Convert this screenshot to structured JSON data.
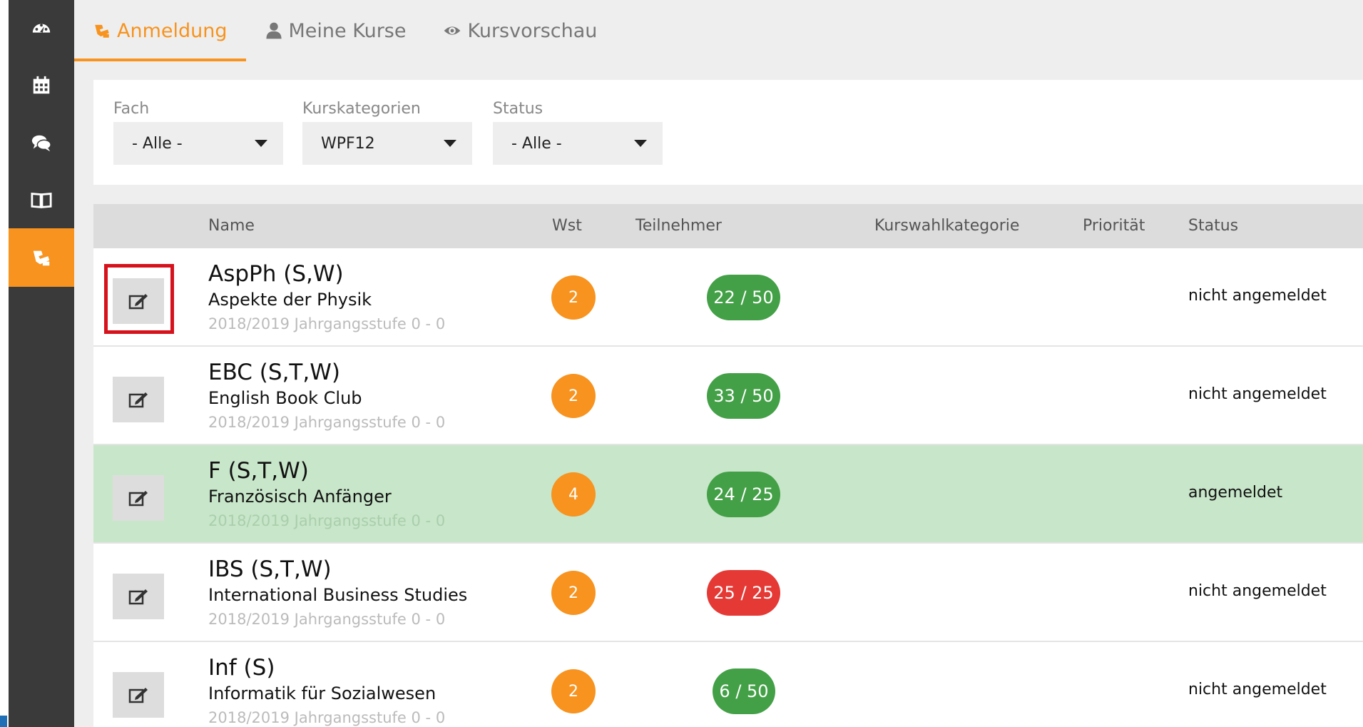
{
  "sidebar": {
    "items": [
      {
        "icon": "dashboard-icon"
      },
      {
        "icon": "calendar-icon"
      },
      {
        "icon": "comments-icon"
      },
      {
        "icon": "book-icon"
      },
      {
        "icon": "course-registration-icon",
        "active": true
      }
    ]
  },
  "tabs": [
    {
      "label": "Anmeldung",
      "icon": "registration-icon",
      "active": true
    },
    {
      "label": "Meine Kurse",
      "icon": "user-icon"
    },
    {
      "label": "Kursvorschau",
      "icon": "eye-icon"
    }
  ],
  "filters": {
    "fach": {
      "label": "Fach",
      "value": "- Alle -"
    },
    "kategorie": {
      "label": "Kurskategorien",
      "value": "WPF12"
    },
    "status": {
      "label": "Status",
      "value": "- Alle -"
    }
  },
  "table": {
    "headers": {
      "name": "Name",
      "wst": "Wst",
      "teilnehmer": "Teilnehmer",
      "kurswahlkategorie": "Kurswahlkategorie",
      "prioritaet": "Priorität",
      "status": "Status"
    },
    "rows": [
      {
        "code": "AspPh (S,W)",
        "title": "Aspekte der Physik",
        "year": "2018/2019 Jahrgangsstufe 0 - 0",
        "wst": "2",
        "participants": "22 / 50",
        "full": false,
        "status": "nicht angemeldet",
        "registered": false,
        "highlighted": true
      },
      {
        "code": "EBC (S,T,W)",
        "title": "English Book Club",
        "year": "2018/2019 Jahrgangsstufe 0 - 0",
        "wst": "2",
        "participants": "33 / 50",
        "full": false,
        "status": "nicht angemeldet",
        "registered": false
      },
      {
        "code": "F (S,T,W)",
        "title": "Französisch Anfänger",
        "year": "2018/2019 Jahrgangsstufe 0 - 0",
        "wst": "4",
        "participants": "24 / 25",
        "full": false,
        "status": "angemeldet",
        "registered": true
      },
      {
        "code": "IBS (S,T,W)",
        "title": "International Business Studies",
        "year": "2018/2019 Jahrgangsstufe 0 - 0",
        "wst": "2",
        "participants": "25 / 25",
        "full": true,
        "status": "nicht angemeldet",
        "registered": false
      },
      {
        "code": "Inf (S)",
        "title": "Informatik für Sozialwesen",
        "year": "2018/2019 Jahrgangsstufe 0 - 0",
        "wst": "2",
        "participants": "6 / 50",
        "full": false,
        "status": "nicht angemeldet",
        "registered": false
      }
    ]
  },
  "colors": {
    "accent": "#f7931e",
    "sidebar": "#3a3a3a",
    "pill_ok": "#43a047",
    "pill_full": "#e53935",
    "registered_row": "#c8e6c9"
  }
}
